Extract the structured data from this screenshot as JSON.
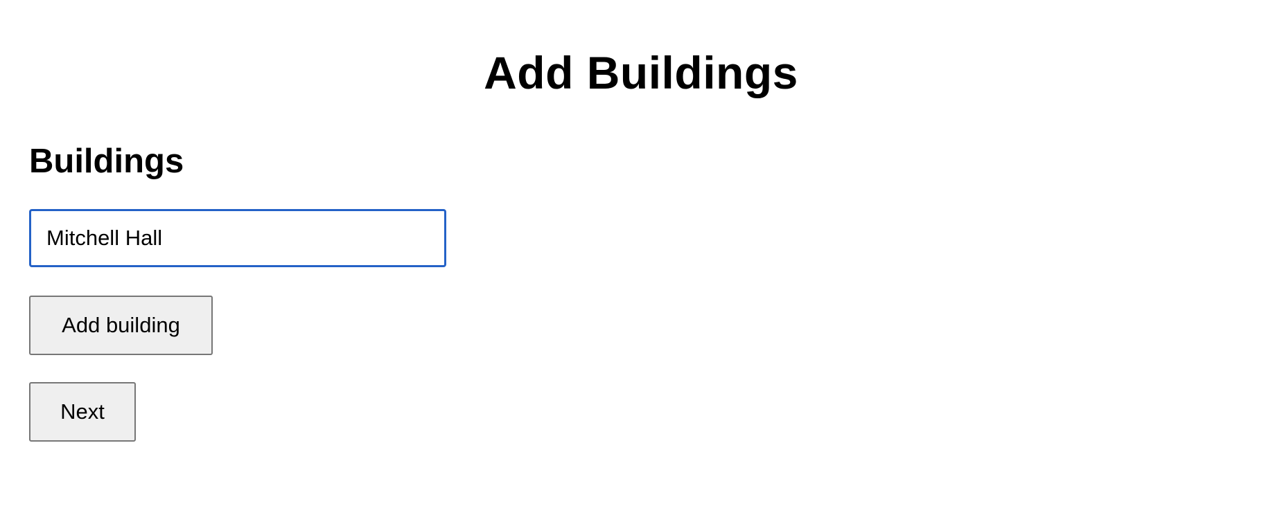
{
  "page": {
    "title": "Add Buildings"
  },
  "buildings_section": {
    "title": "Buildings",
    "input_value": "Mitchell Hall",
    "input_placeholder": "",
    "add_button_label": "Add building"
  },
  "navigation": {
    "next_button_label": "Next"
  },
  "colors": {
    "focus_border": "#2462c7",
    "button_background": "#efefef",
    "button_border": "#767676"
  }
}
